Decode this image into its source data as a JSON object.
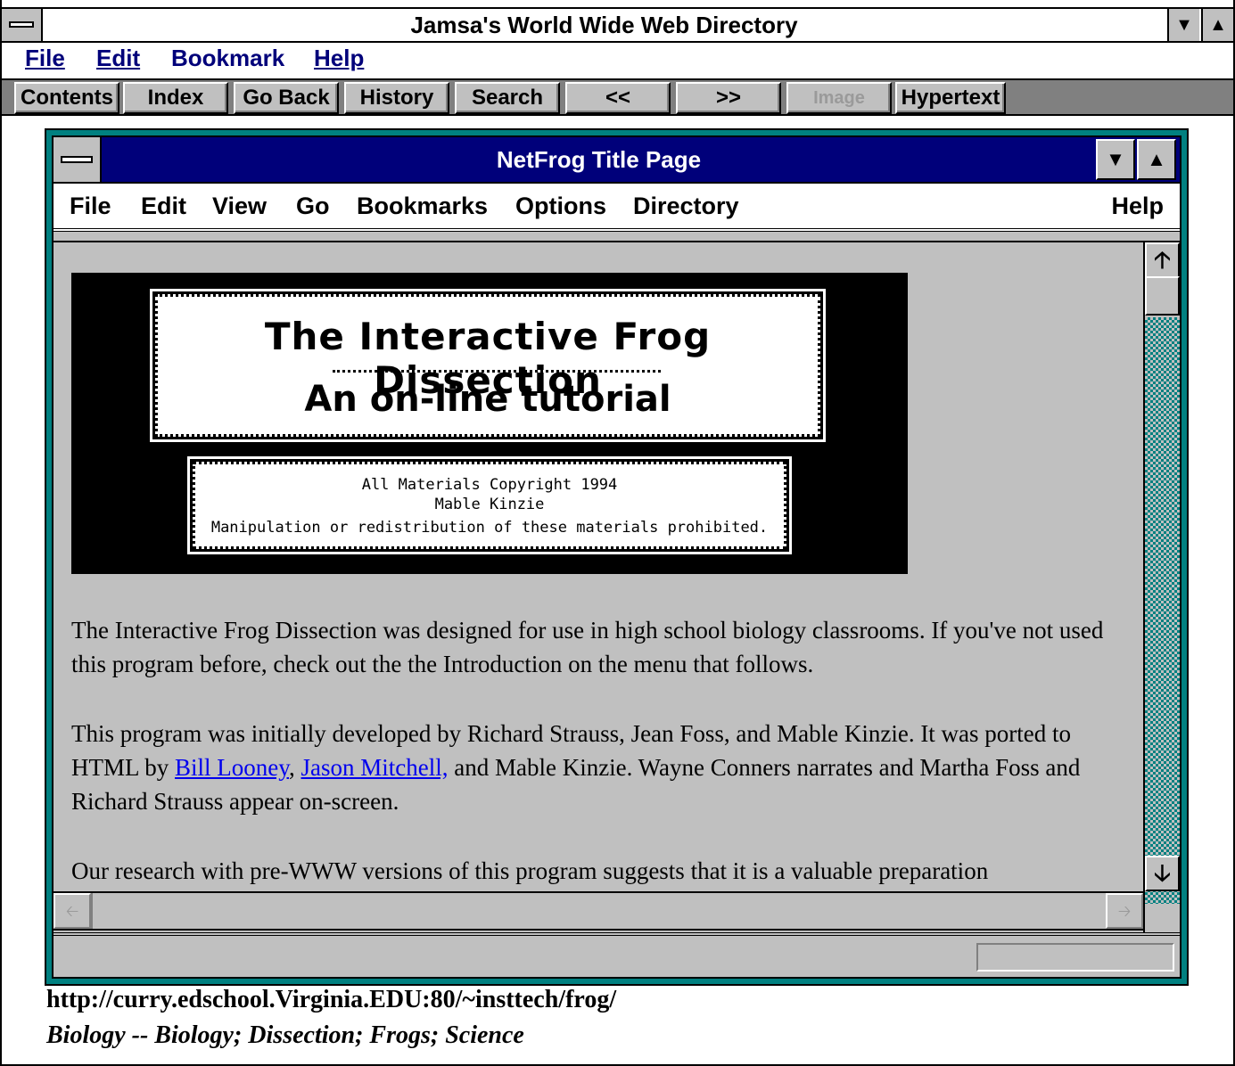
{
  "outer_window": {
    "title": "Jamsa's World Wide Web Directory",
    "menu": [
      "File",
      "Edit",
      "Bookmark",
      "Help"
    ],
    "toolbar": [
      "Contents",
      "Index",
      "Go Back",
      "History",
      "Search",
      "<<",
      ">>",
      "Image",
      "Hypertext"
    ]
  },
  "inner_window": {
    "title": "NetFrog Title Page",
    "menu": [
      "File",
      "Edit",
      "View",
      "Go",
      "Bookmarks",
      "Options",
      "Directory",
      "Help"
    ],
    "banner": {
      "title": "The Interactive Frog Dissection",
      "subtitle": "An on-line tutorial",
      "copyright_lines": [
        "All Materials Copyright 1994",
        "Mable Kinzie",
        "Manipulation or redistribution of these materials prohibited."
      ]
    },
    "paragraphs": {
      "p1": "The Interactive Frog Dissection was designed for use in high school biology classrooms. If you've not used this program before, check out the the Introduction on the menu that follows.",
      "p2_before": "This program was initially developed by Richard Strauss, Jean Foss, and Mable Kinzie. It was ported to HTML by ",
      "p2_link1": "Bill Looney",
      "p2_sep": ", ",
      "p2_link2": "Jason Mitchell,",
      "p2_after": " and Mable Kinzie. Wayne Conners narrates and Martha Foss and Richard Strauss appear on-screen.",
      "p3": "Our research with pre-WWW versions of this program suggests that it is a valuable preparation"
    }
  },
  "entry": {
    "url": "http://curry.edschool.Virginia.EDU:80/~insttech/frog/",
    "categories": "Biology -- Biology; Dissection; Frogs; Science"
  }
}
